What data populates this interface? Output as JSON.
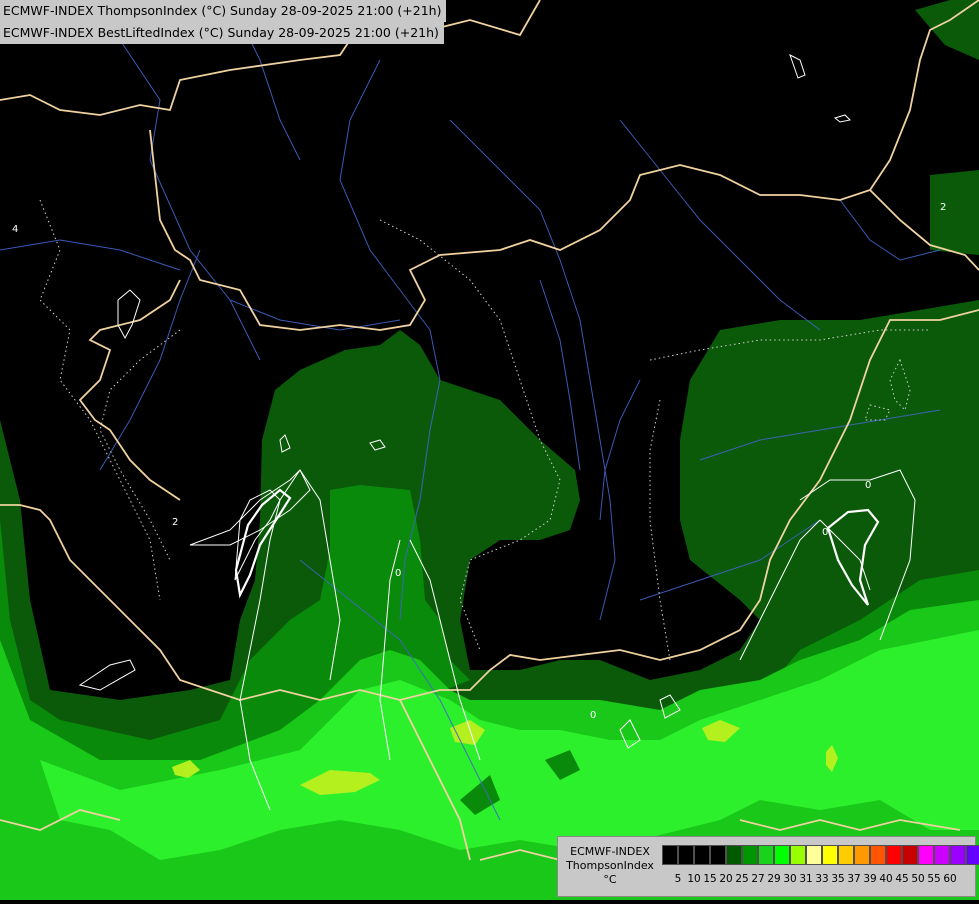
{
  "header": {
    "line1": "ECMWF-INDEX ThompsonIndex (°C) Sunday 28-09-2025 21:00 (+21h)",
    "line2": "ECMWF-INDEX BestLiftedIndex (°C) Sunday 28-09-2025 21:00 (+21h)"
  },
  "legend": {
    "title1": "ECMWF-INDEX",
    "title2": "ThompsonIndex",
    "title3": "°C",
    "ticks": [
      "5",
      "10",
      "15",
      "20",
      "25",
      "27",
      "29",
      "30",
      "31",
      "33",
      "35",
      "37",
      "39",
      "40",
      "45",
      "50",
      "55",
      "60"
    ],
    "colors": [
      "#000000",
      "#000000",
      "#000000",
      "#000000",
      "#005a00",
      "#009600",
      "#19d219",
      "#00ff00",
      "#99ff00",
      "#ffff99",
      "#ffff00",
      "#ffcc00",
      "#ff9900",
      "#ff5500",
      "#ff0000",
      "#c80000",
      "#ff00ff",
      "#cc00ff",
      "#9900ff",
      "#6600ff",
      "#0000ff"
    ]
  },
  "contour_labels": [
    "4",
    "2",
    "2",
    "0",
    "0",
    "0",
    "0"
  ],
  "colors": {
    "background": "#000000",
    "dark_green": "#0a5a0a",
    "mid_green": "#0a8a0a",
    "green": "#19c819",
    "bright_green": "#2df02d",
    "yellow_green": "#b4f01e",
    "border": "#f0d2a0",
    "river": "#4164c8",
    "contour": "#ffffff"
  }
}
